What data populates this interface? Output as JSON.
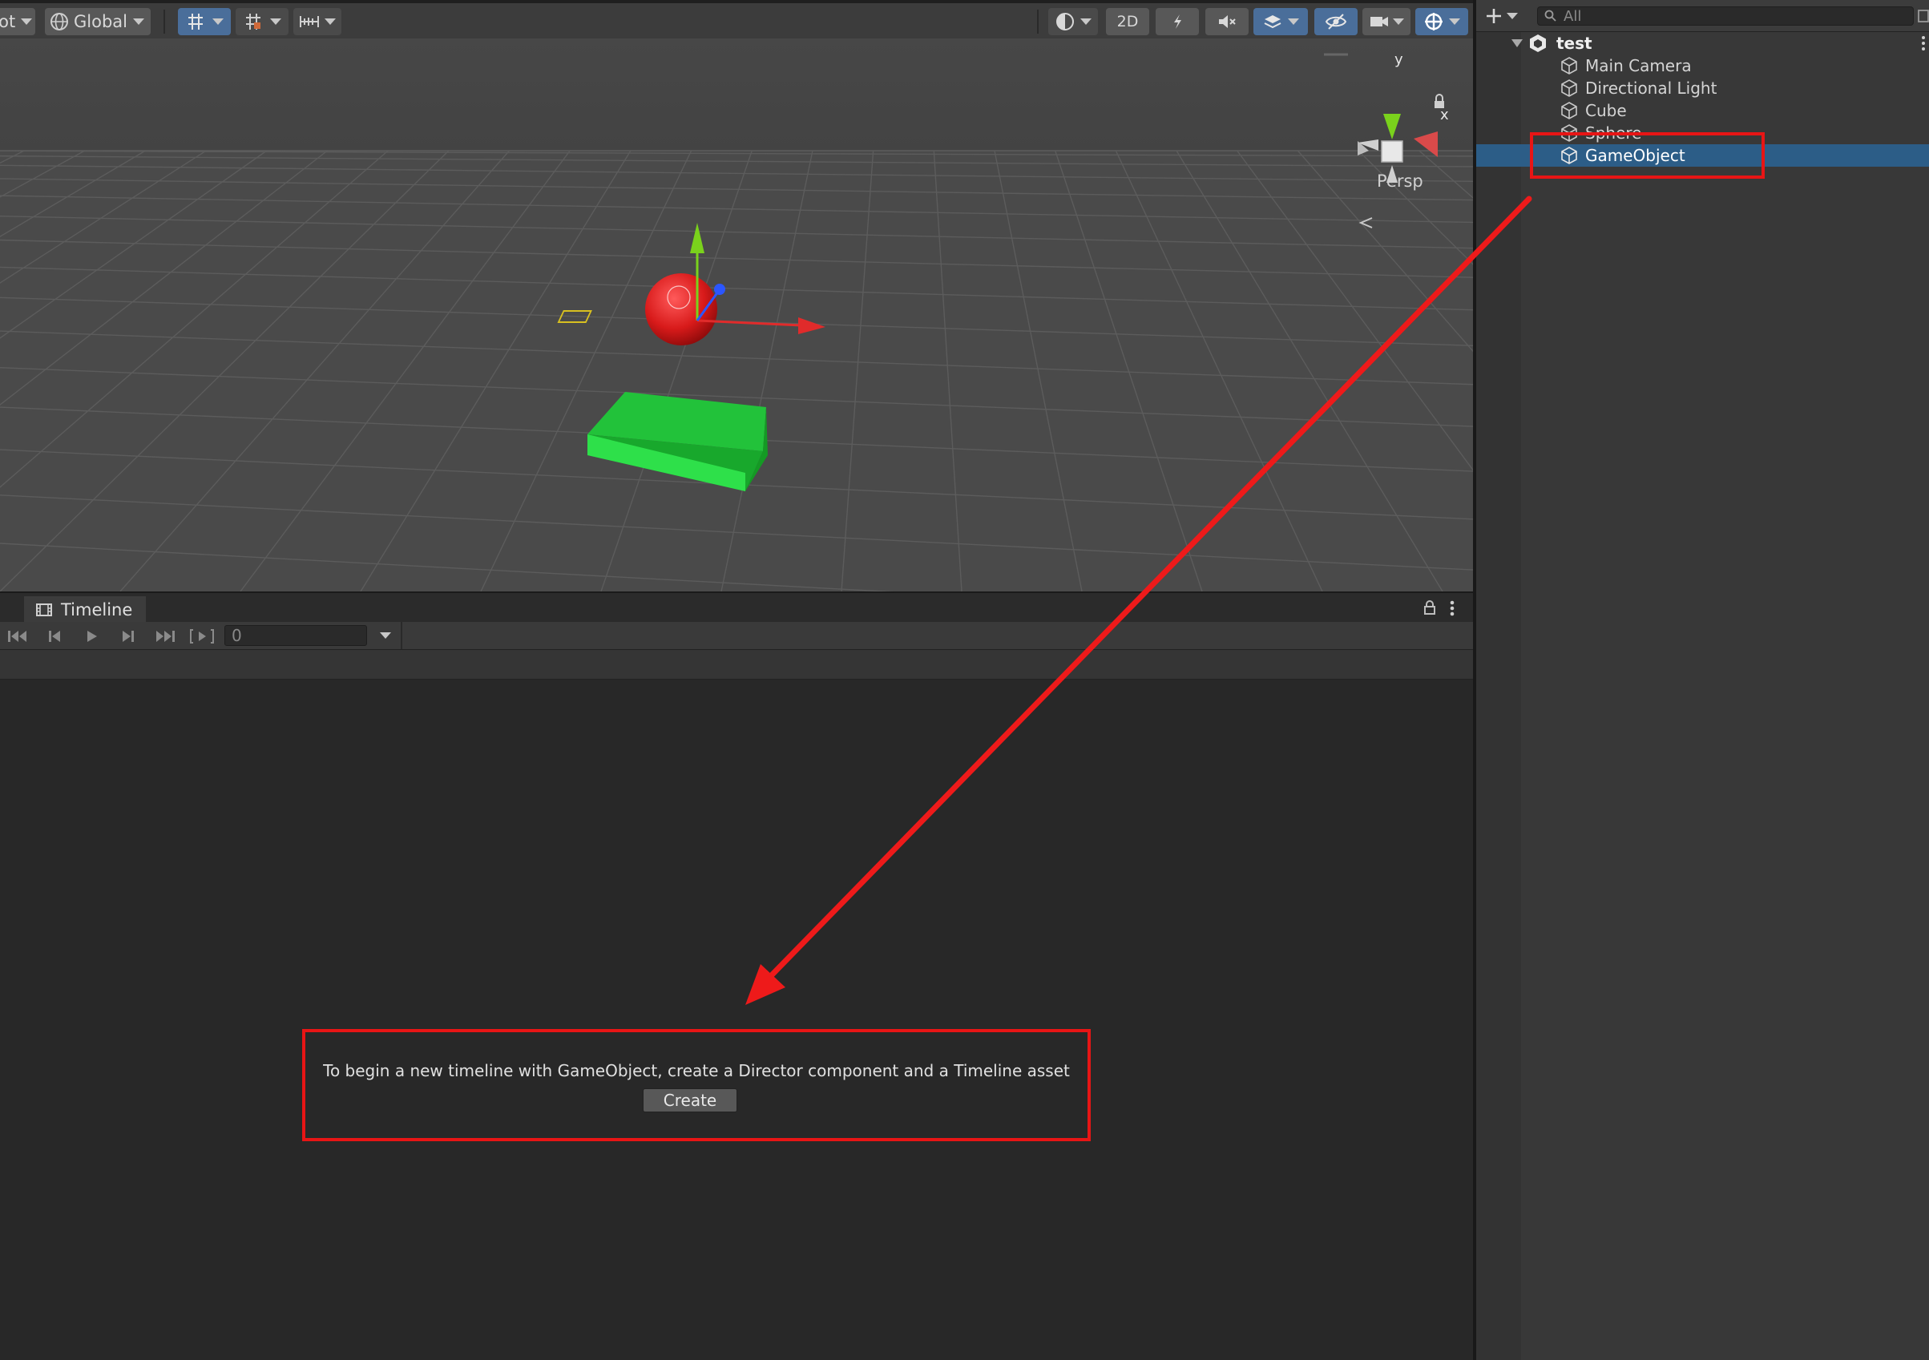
{
  "scene_toolbar": {
    "pivot_label_fragment": "ot",
    "handle_rotation_label": "Global",
    "mode_2d_label": "2D"
  },
  "scene_view": {
    "gizmo_axis_y": "y",
    "gizmo_axis_x": "x",
    "projection_label": "Persp"
  },
  "timeline": {
    "tab_label": "Timeline",
    "frame_value": "0",
    "prompt_message": "To begin a new timeline with GameObject, create a Director component and a Timeline asset",
    "create_label": "Create"
  },
  "hierarchy": {
    "search_placeholder": "All",
    "scene_name": "test",
    "items": [
      {
        "label": "Main Camera",
        "selected": false
      },
      {
        "label": "Directional Light",
        "selected": false
      },
      {
        "label": "Cube",
        "selected": false
      },
      {
        "label": "Sphere",
        "selected": false
      },
      {
        "label": "GameObject",
        "selected": true
      }
    ]
  },
  "colors": {
    "selection": "#2c5d87",
    "annotation": "#e81515",
    "toggle_active": "#4a6e9a"
  }
}
